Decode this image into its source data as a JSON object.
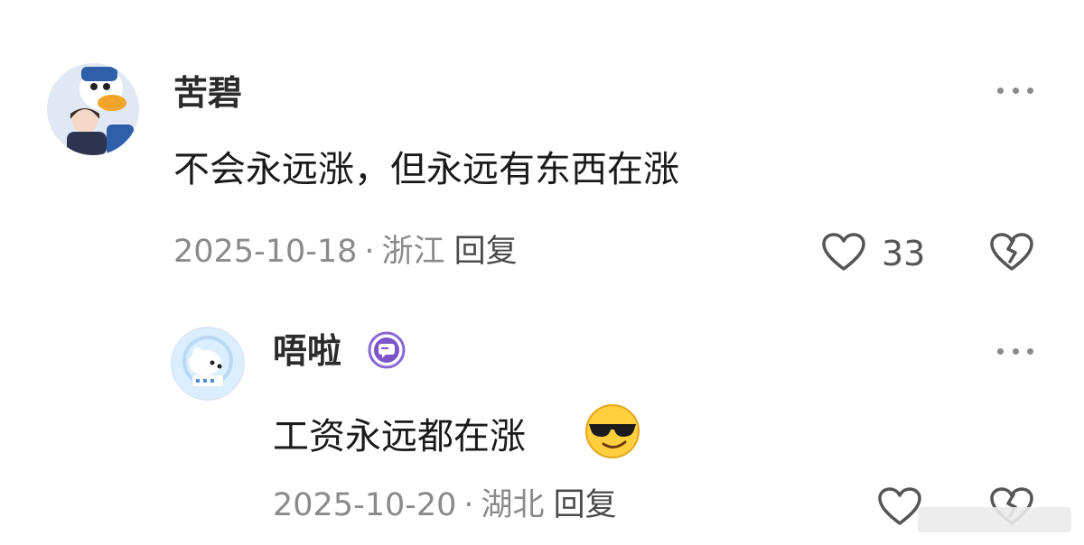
{
  "comments": [
    {
      "username": "苦碧",
      "text": "不会永远涨，但永远有东西在涨",
      "date": "2025-10-18",
      "separator": "·",
      "location": "浙江",
      "reply_label": "回复",
      "like_count": "33",
      "avatar_icon": "donald-duck-avatar-icon"
    },
    {
      "username": "唔啦",
      "text": "工资永远都在涨",
      "emoji": "sunglasses-emoji-icon",
      "badge_icon": "message-badge-icon",
      "date": "2025-10-20",
      "separator": "·",
      "location": "湖北",
      "reply_label": "回复",
      "like_count": "",
      "avatar_icon": "polar-bear-avatar-icon"
    }
  ],
  "colors": {
    "text": "#1a1a1a",
    "meta": "#8a8a8a",
    "badge": "#7b55c9"
  }
}
